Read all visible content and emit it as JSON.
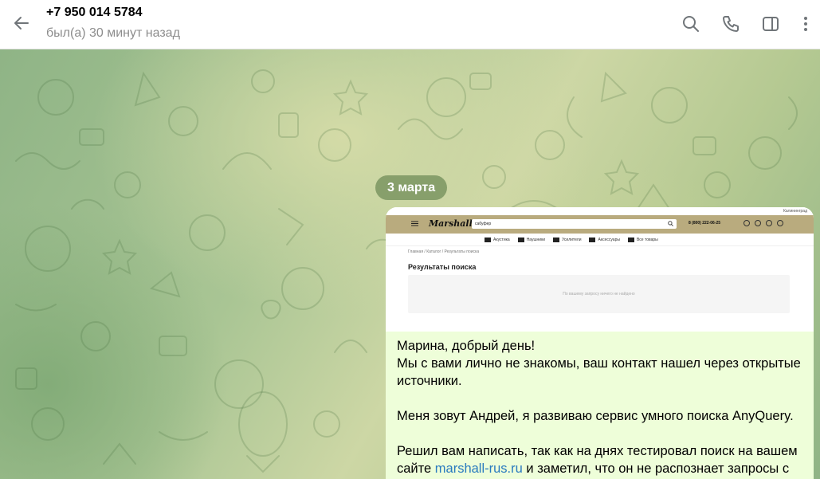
{
  "header": {
    "title": "+7 950 014 5784",
    "status": "был(а) 30 минут назад",
    "icons": [
      "back-arrow-icon",
      "search-icon",
      "phone-icon",
      "sidebar-toggle-icon",
      "more-vertical-icon"
    ]
  },
  "chat": {
    "date_label": "3 марта",
    "message": {
      "preview": {
        "city": "Калининград",
        "logo": "Marshall",
        "search_value": "сабуфер",
        "phone": "8 (800) 222-06-25",
        "cart_count": "0",
        "categories": [
          "Акустика",
          "Наушники",
          "Усилители",
          "Аксессуары",
          "Все товары"
        ],
        "breadcrumb": "Главная / Каталог / Результаты поиска",
        "heading": "Результаты поиска",
        "empty_text": "По вашему запросу ничего не найдено"
      },
      "greeting": "Марина, добрый день!",
      "line2": "Мы с вами лично не знакомы, ваш контакт нашел через открытые источники.",
      "line3": "Меня зовут Андрей, я развиваю сервис умного поиска AnyQuery.",
      "line4_before": "Решил вам написать, так как на днях тестировал поиск на вашем сайте ",
      "link_text": "marshall-rus.ru",
      "line4_after": " и заметил, что он не распознает запросы с"
    }
  },
  "colors": {
    "bubble": "#eefed9",
    "date_pill": "#708c58",
    "link": "#2a7bbf",
    "status": "#8d8d8d"
  }
}
